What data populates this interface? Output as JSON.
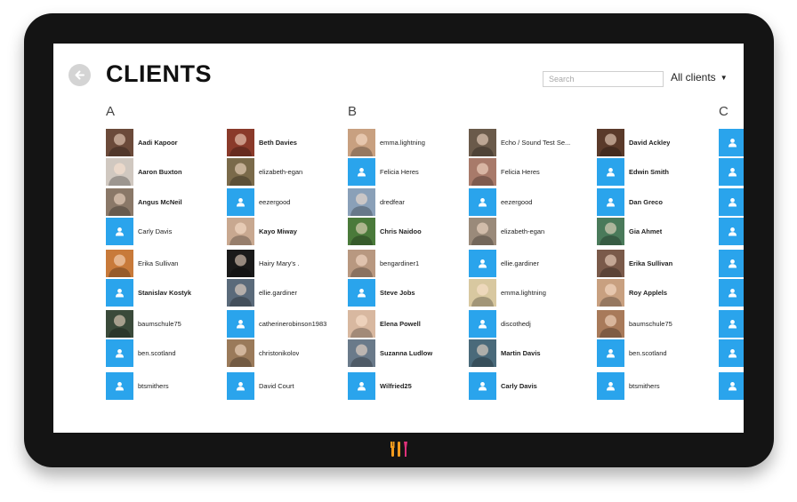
{
  "header": {
    "title": "CLIENTS",
    "search_placeholder": "Search",
    "filter_label": "All clients"
  },
  "sections": [
    {
      "letter": "A",
      "columns": [
        [
          {
            "name": "Aadi Kapoor",
            "avatar": "photo",
            "bold": true,
            "color": "#6b4a3a"
          },
          {
            "name": "Aaron Buxton",
            "avatar": "photo",
            "bold": true,
            "color": "#d0c8c0"
          },
          {
            "name": "Angus McNeil",
            "avatar": "photo",
            "bold": true,
            "color": "#8a7868"
          },
          {
            "name": "Carly Davis",
            "avatar": "placeholder",
            "bold": false
          },
          {
            "name": "Erika Sullivan",
            "avatar": "photo",
            "bold": false,
            "color": "#c87a3a"
          },
          {
            "name": "Stanislav Kostyk",
            "avatar": "placeholder",
            "bold": true
          },
          {
            "name": "baumschule75",
            "avatar": "photo",
            "bold": false,
            "color": "#3a4a3a"
          },
          {
            "name": "ben.scotland",
            "avatar": "placeholder",
            "bold": false
          },
          {
            "name": "btsmithers",
            "avatar": "placeholder",
            "bold": false
          }
        ],
        [
          {
            "name": "Beth Davies",
            "avatar": "photo",
            "bold": true,
            "color": "#8a3a2a"
          },
          {
            "name": "elizabeth-egan",
            "avatar": "photo",
            "bold": false,
            "color": "#7a6a4a"
          },
          {
            "name": "eezergood",
            "avatar": "placeholder",
            "bold": false
          },
          {
            "name": "Kayo Miway",
            "avatar": "photo",
            "bold": true,
            "color": "#c8a890"
          },
          {
            "name": "Hairy Mary's .",
            "avatar": "photo",
            "bold": false,
            "color": "#1a1a1a"
          },
          {
            "name": "ellie.gardiner",
            "avatar": "photo",
            "bold": false,
            "color": "#5a6a7a"
          },
          {
            "name": "catherinerobinson1983",
            "avatar": "placeholder",
            "bold": false
          },
          {
            "name": "christonikolov",
            "avatar": "photo",
            "bold": false,
            "color": "#9a7a5a"
          },
          {
            "name": "David Court",
            "avatar": "placeholder",
            "bold": false
          }
        ]
      ]
    },
    {
      "letter": "B",
      "columns": [
        [
          {
            "name": "emma.lightning",
            "avatar": "photo",
            "bold": false,
            "color": "#c8a080"
          },
          {
            "name": "Felicia Heres",
            "avatar": "placeholder",
            "bold": false
          },
          {
            "name": "dredfear",
            "avatar": "photo",
            "bold": false,
            "color": "#8aa0b8"
          },
          {
            "name": "Chris Naidoo",
            "avatar": "photo",
            "bold": true,
            "color": "#4a7a3a"
          },
          {
            "name": "bengardiner1",
            "avatar": "photo",
            "bold": false,
            "color": "#b89880"
          },
          {
            "name": "Steve Jobs",
            "avatar": "placeholder",
            "bold": true
          },
          {
            "name": "Elena Powell",
            "avatar": "photo",
            "bold": true,
            "color": "#d8b8a0"
          },
          {
            "name": "Suzanna Ludlow",
            "avatar": "photo",
            "bold": true,
            "color": "#6a7a8a"
          },
          {
            "name": "Wilfried25",
            "avatar": "placeholder",
            "bold": true
          }
        ],
        [
          {
            "name": "Echo / Sound Test Se...",
            "avatar": "photo",
            "bold": false,
            "color": "#6a5a4a"
          },
          {
            "name": "Felicia Heres",
            "avatar": "photo",
            "bold": false,
            "color": "#a87a6a"
          },
          {
            "name": "eezergood",
            "avatar": "placeholder",
            "bold": false
          },
          {
            "name": "elizabeth-egan",
            "avatar": "photo",
            "bold": false,
            "color": "#9a8a7a"
          },
          {
            "name": "ellie.gardiner",
            "avatar": "placeholder",
            "bold": false
          },
          {
            "name": "emma.lightning",
            "avatar": "photo",
            "bold": false,
            "color": "#d8c8a0"
          },
          {
            "name": "discothedj",
            "avatar": "placeholder",
            "bold": false
          },
          {
            "name": "Martin Davis",
            "avatar": "photo",
            "bold": true,
            "color": "#4a6a7a"
          },
          {
            "name": "Carly Davis",
            "avatar": "placeholder",
            "bold": true
          }
        ],
        [
          {
            "name": "David Ackley",
            "avatar": "photo",
            "bold": true,
            "color": "#5a3a2a"
          },
          {
            "name": "Edwin Smith",
            "avatar": "placeholder",
            "bold": true
          },
          {
            "name": "Dan Greco",
            "avatar": "placeholder",
            "bold": true
          },
          {
            "name": "Gia Ahmet",
            "avatar": "photo",
            "bold": true,
            "color": "#4a7a5a"
          },
          {
            "name": "Erika Sullivan",
            "avatar": "photo",
            "bold": true,
            "color": "#7a5a4a"
          },
          {
            "name": "Roy Applels",
            "avatar": "photo",
            "bold": true,
            "color": "#c8a080"
          },
          {
            "name": "baumschule75",
            "avatar": "photo",
            "bold": false,
            "color": "#a87a5a"
          },
          {
            "name": "ben.scotland",
            "avatar": "placeholder",
            "bold": false
          },
          {
            "name": "btsmithers",
            "avatar": "placeholder",
            "bold": false
          }
        ]
      ]
    },
    {
      "letter": "C",
      "columns": [
        [
          {
            "name": "",
            "avatar": "placeholder",
            "bold": false
          },
          {
            "name": "",
            "avatar": "placeholder",
            "bold": false
          },
          {
            "name": "",
            "avatar": "placeholder",
            "bold": false
          },
          {
            "name": "",
            "avatar": "placeholder",
            "bold": false
          },
          {
            "name": "",
            "avatar": "placeholder",
            "bold": false
          },
          {
            "name": "",
            "avatar": "placeholder",
            "bold": false
          },
          {
            "name": "",
            "avatar": "placeholder",
            "bold": false
          },
          {
            "name": "",
            "avatar": "placeholder",
            "bold": false
          },
          {
            "name": "",
            "avatar": "placeholder",
            "bold": false
          }
        ]
      ]
    }
  ],
  "colors": {
    "accent": "#2aa4ec",
    "frame": "#141414",
    "logo_orange": "#f29b1e",
    "logo_pink": "#e0317a"
  }
}
